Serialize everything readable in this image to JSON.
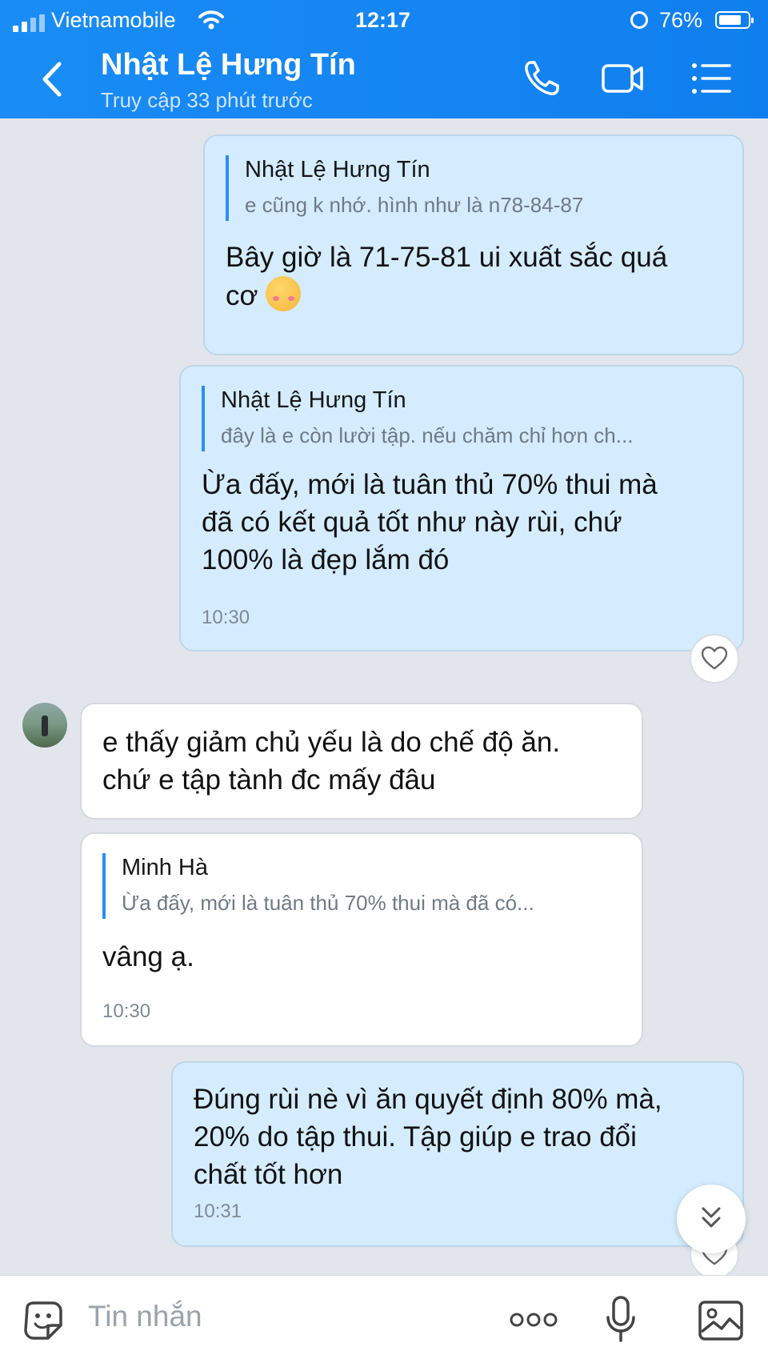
{
  "status_bar": {
    "carrier": "Vietnamobile",
    "time": "12:17",
    "battery": "76%"
  },
  "header": {
    "title": "Nhật Lệ Hưng Tín",
    "subtitle": "Truy cập 33 phút trước",
    "icons": [
      "back-icon",
      "phone-icon",
      "video-call-icon",
      "menu-icon"
    ]
  },
  "messages": [
    {
      "direction": "outgoing",
      "quote_name": "Nhật Lệ Hưng Tín",
      "quote_text": "e cũng k nhớ. hình như là n78-84-87",
      "text_line1": "Bây giờ là 71-75-81 ui xuất sắc quá",
      "text_line2": "cơ",
      "emoji": "smiling-face-with-hearts"
    },
    {
      "direction": "outgoing",
      "quote_name": "Nhật Lệ Hưng Tín",
      "quote_text": "đây là e còn lười tập. nếu chăm chỉ hơn ch...",
      "text_line1": "Ừa đấy, mới là tuân thủ 70% thui mà",
      "text_line2": "đã có kết quả tốt như này rùi, chứ",
      "text_line3": "100% là đẹp lắm đó",
      "time": "10:30"
    },
    {
      "direction": "incoming",
      "text_line1": "e thấy giảm chủ yếu là do chế độ ăn.",
      "text_line2": "chứ e tập tành đc mấy đâu"
    },
    {
      "direction": "incoming",
      "quote_name": "Minh Hà",
      "quote_text": "Ừa đấy, mới là tuân thủ 70% thui mà đã có...",
      "text_line1": "vâng ạ.",
      "time": "10:30"
    },
    {
      "direction": "outgoing",
      "text_line1": "Đúng rùi nè vì ăn quyết định 80% mà,",
      "text_line2": "20% do tập thui. Tập giúp e trao đổi",
      "text_line3": "chất tốt hơn",
      "time": "10:31"
    }
  ],
  "input_bar": {
    "placeholder": "Tin nhắn"
  },
  "colors": {
    "header_blue": "#1a8cf5",
    "outgoing_bubble": "#d4ecfd",
    "incoming_bubble": "#ffffff",
    "chat_background": "#e2e6ec",
    "quote_bar": "#2b8ef3"
  }
}
